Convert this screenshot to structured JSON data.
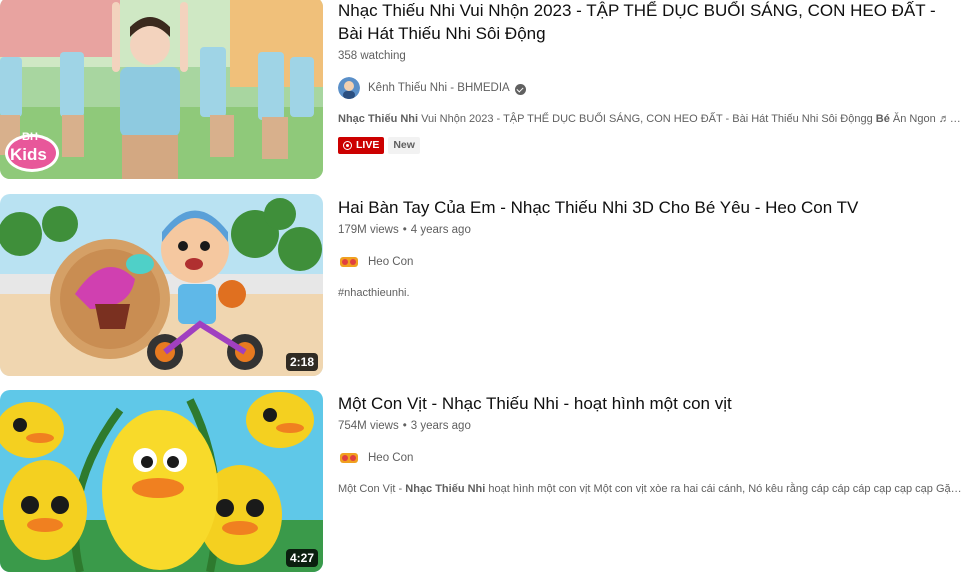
{
  "results": [
    {
      "title": "Nhạc Thiếu Nhi Vui Nhộn 2023 - TẬP THỂ DỤC BUỔI SÁNG, CON HEO ĐẤT - Bài Hát Thiếu Nhi Sôi Động",
      "watching": "358 watching",
      "channel": "Kênh Thiếu Nhi - BHMEDIA",
      "description_bold_1": "Nhạc Thiếu Nhi",
      "description_rest_1": " Vui Nhộn 2023 - TẬP THỂ DỤC BUỔI SÁNG, CON HEO ĐẤT - Bài Hát Thiếu Nhi Sôi Độngg ",
      "description_bold_2": "Bé",
      "description_rest_2": " Ăn Ngon ♬ Nhạc ...",
      "live_label": "LIVE",
      "new_label": "New",
      "thumb_logo_top": "BH",
      "thumb_logo_bottom": "Kids"
    },
    {
      "title": "Hai Bàn Tay Của Em - Nhạc Thiếu Nhi 3D Cho Bé Yêu - Heo Con TV",
      "views": "179M views",
      "age": "4 years ago",
      "channel": "Heo Con",
      "description": "#nhacthieunhi.",
      "duration": "2:18"
    },
    {
      "title": "Một Con Vịt - Nhạc Thiếu Nhi - hoạt hình một con vịt",
      "views": "754M views",
      "age": "3 years ago",
      "channel": "Heo Con",
      "description_rest_1": "Một Con Vịt - ",
      "description_bold_1": "Nhạc Thiếu Nhi",
      "description_rest_2": " hoạt hình một con vịt Một con vịt xòe ra hai cái cánh, Nó kêu rằng cáp cáp cáp cạp cạp cạp Gặp hồ ...",
      "duration": "4:27"
    }
  ],
  "separator": "•",
  "colors": {
    "live": "#cc0000",
    "meta_text": "#606060",
    "title_text": "#0f0f0f"
  },
  "icons": {
    "verified": "verified-check-icon",
    "live": "live-broadcast-icon"
  }
}
